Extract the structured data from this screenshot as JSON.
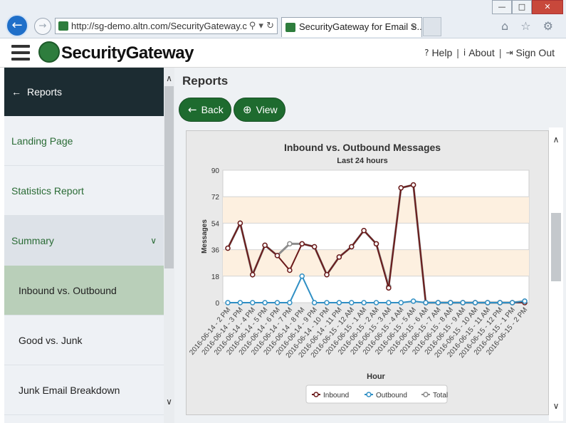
{
  "browser": {
    "url": "http://sg-demo.altn.com/SecurityGateway.c",
    "tab_title": "SecurityGateway for Email S...",
    "tab_close": "×",
    "address_tools": "⚲ ▾ ↻",
    "win_min": "—",
    "win_max": "□",
    "win_close": "✕",
    "chrome_icons": "⌂ ☆ ⚙"
  },
  "header": {
    "brand": "SecurityGateway",
    "help": "Help",
    "about": "About",
    "signout": "Sign Out",
    "sep": "|"
  },
  "sidebar": {
    "back_label": "Reports",
    "items": [
      {
        "label": "Landing Page"
      },
      {
        "label": "Statistics Report"
      },
      {
        "label": "Summary"
      },
      {
        "label": "Inbound vs. Outbound"
      },
      {
        "label": "Good vs. Junk"
      },
      {
        "label": "Junk Email Breakdown"
      }
    ]
  },
  "main": {
    "title": "Reports",
    "back_button": "Back",
    "view_button": "View"
  },
  "icons": {
    "back_arrow": "🡐",
    "nav_back": "←",
    "nav_fwd": "→",
    "chevron_down": "∨",
    "scroll_up": "∧",
    "scroll_down": "∨",
    "help": "?",
    "about": "i",
    "signout": "⇥",
    "zoom": "⊕"
  },
  "colors": {
    "accent_green": "#1e6b2f",
    "inbound": "#6b1a1a",
    "outbound": "#2f8fc4",
    "total": "#8c8c8c",
    "band": "#fdf0e0"
  },
  "chart_data": {
    "type": "line",
    "title": "Inbound vs. Outbound Messages",
    "subtitle": "Last 24 hours",
    "xlabel": "Hour",
    "ylabel": "Messages",
    "ylim": [
      0,
      90
    ],
    "yticks": [
      0,
      18,
      36,
      54,
      72,
      90
    ],
    "legend_position": "bottom",
    "categories": [
      "2016-06-14 - 2 PM",
      "2016-06-14 - 3 PM",
      "2016-06-14 - 4 PM",
      "2016-06-14 - 5 PM",
      "2016-06-14 - 6 PM",
      "2016-06-14 - 7 PM",
      "2016-06-14 - 8 PM",
      "2016-06-14 - 9 PM",
      "2016-06-14 - 10 PM",
      "2016-06-14 - 11 PM",
      "2016-06-15 - 12 AM",
      "2016-06-15 - 1 AM",
      "2016-06-15 - 2 AM",
      "2016-06-15 - 3 AM",
      "2016-06-15 - 4 AM",
      "2016-06-15 - 5 AM",
      "2016-06-15 - 6 AM",
      "2016-06-15 - 7 AM",
      "2016-06-15 - 8 AM",
      "2016-06-15 - 9 AM",
      "2016-06-15 - 10 AM",
      "2016-06-15 - 11 AM",
      "2016-06-15 - 12 PM",
      "2016-06-15 - 1 PM",
      "2016-06-15 - 2 PM"
    ],
    "series": [
      {
        "name": "Inbound",
        "values": [
          37,
          54,
          19,
          39,
          32,
          22,
          40,
          38,
          19,
          31,
          38,
          49,
          40,
          10,
          78,
          80,
          0,
          0,
          0,
          0,
          0,
          0,
          0,
          0,
          0
        ]
      },
      {
        "name": "Outbound",
        "values": [
          0,
          0,
          0,
          0,
          0,
          0,
          18,
          0,
          0,
          0,
          0,
          0,
          0,
          0,
          0,
          1,
          0,
          0,
          0,
          0,
          0,
          0,
          0,
          0,
          1
        ]
      },
      {
        "name": "Total",
        "values": [
          37,
          54,
          19,
          39,
          32,
          40,
          40,
          38,
          19,
          31,
          38,
          49,
          40,
          11,
          78,
          80,
          0,
          0,
          0,
          0,
          0,
          0,
          0,
          0,
          1
        ]
      }
    ]
  }
}
